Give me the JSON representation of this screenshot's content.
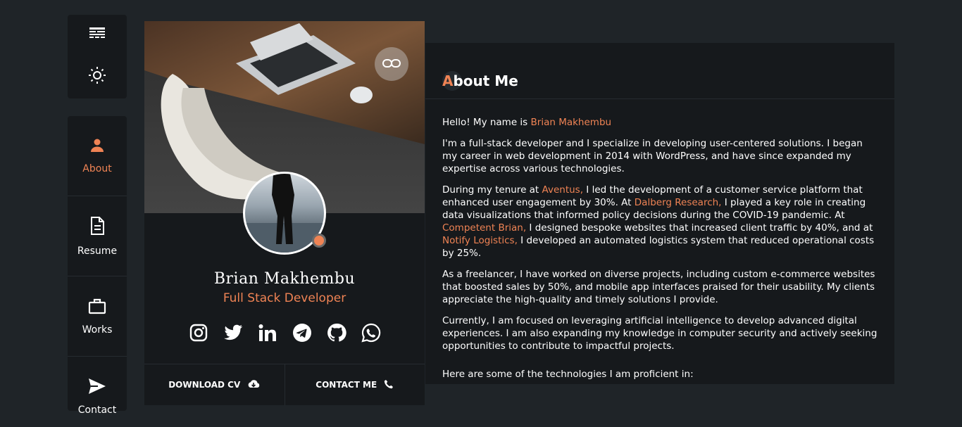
{
  "rail": {
    "top_icons": [
      "layout-icon",
      "theme-toggle-icon"
    ],
    "nav": [
      {
        "label": "About",
        "icon": "user-icon",
        "active": true
      },
      {
        "label": "Resume",
        "icon": "document-icon",
        "active": false
      },
      {
        "label": "Works",
        "icon": "briefcase-icon",
        "active": false
      },
      {
        "label": "Contact",
        "icon": "send-icon",
        "active": false
      }
    ]
  },
  "profile": {
    "name": "Brian Makhembu",
    "role": "Full Stack Developer",
    "socials": [
      "instagram-icon",
      "twitter-icon",
      "linkedin-icon",
      "telegram-icon",
      "github-icon",
      "whatsapp-icon"
    ],
    "download_cv": "DOWNLOAD CV",
    "contact_me": "CONTACT ME"
  },
  "about": {
    "title_first": "A",
    "title_rest": "bout Me",
    "greeting_prefix": "Hello! My name is ",
    "greeting_name": "Brian Makhembu",
    "p1": "I'm a full-stack developer and I specialize in developing user-centered  solutions. I began my career in web development in 2014 with WordPress, and have since expanded my expertise across various technologies.",
    "p2_a": "During my tenure at ",
    "p2_co1": "Aventus,",
    "p2_b": " I led the development of a customer service platform that enhanced user engagement by 30%. At ",
    "p2_co2": "Dalberg Research,",
    "p2_c": " I played a key role in creating data visualizations that informed policy decisions during the COVID-19 pandemic. At ",
    "p2_co3": "Competent Brian,",
    "p2_d": " I designed bespoke websites that increased client traffic by 40%, and at ",
    "p2_co4": "Notify Logistics,",
    "p2_e": " I developed an automated logistics system that reduced operational costs by 25%.",
    "p3": "As a freelancer, I have worked on diverse projects, including custom e-commerce websites that boosted sales by 50%, and mobile app interfaces praised for their usability. My clients appreciate the high-quality and timely solutions I provide.",
    "p4": "Currently, I am focused on leveraging artificial intelligence to develop advanced digital experiences. I am also expanding my knowledge in computer security and actively seeking opportunities to contribute to impactful projects.",
    "tech_intro": "Here are some of the technologies I am proficient in:"
  },
  "colors": {
    "accent": "#ef8354",
    "panel": "#16191c",
    "background": "#1f2428"
  }
}
